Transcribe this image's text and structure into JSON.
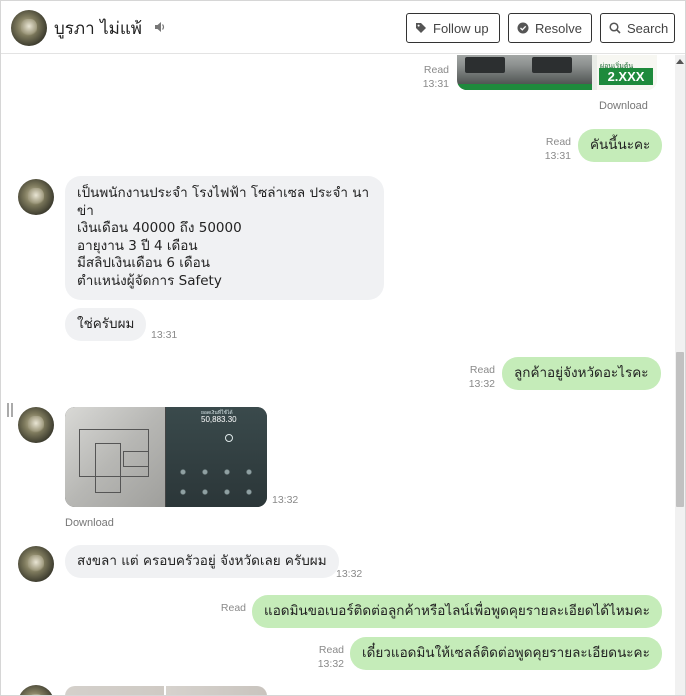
{
  "header": {
    "name": "บูรภา ไม่แพ้",
    "buttons": {
      "follow_up": "Follow up",
      "resolve": "Resolve",
      "search": "Search"
    }
  },
  "messages": {
    "m0": {
      "read": "Read",
      "time": "13:31",
      "download": "Download",
      "ad_price": "2.XXX",
      "ad_caption": "ผ่อนเริ่มต้น"
    },
    "m1": {
      "text": "คันนี้นะคะ",
      "read": "Read",
      "time": "13:31"
    },
    "m2": {
      "text": "เป็นพนักงานประจำ โรงไฟฟ้า โซล่าเซล ประจำ นาข่า\n เงินเดือน 40000 ถึง 50000\nอายุงาน 3 ปี 4 เดือน\nมีสลิปเงินเดือน 6 เดือน\nตำแหน่งผู้จัดการ Safety"
    },
    "m3": {
      "text": "ใช่ครับผม",
      "time": "13:31"
    },
    "m4": {
      "text": "ลูกค้าอยู่จังหวัดอะไรคะ",
      "read": "Read",
      "time": "13:32"
    },
    "m5": {
      "time": "13:32",
      "download": "Download",
      "screen_amount": "50,883.30",
      "screen_title": "ยอดเงินที่ใช้ได้"
    },
    "m6": {
      "text": "สงขลา แต่ ครอบครัวอยู่ จังหวัดเลย ครับผม",
      "time": "13:32"
    },
    "m7": {
      "text": "แอดมินขอเบอร์ติดต่อลูกค้าหรือไลน์เพื่อพูดคุยรายละเอียดได้ไหมคะ",
      "read": "Read"
    },
    "m8": {
      "text": "เดี๋ยวแอดมินให้เซลล์ติดต่อพูดคุยรายละเอียดนะคะ",
      "read": "Read",
      "time": "13:32"
    }
  }
}
